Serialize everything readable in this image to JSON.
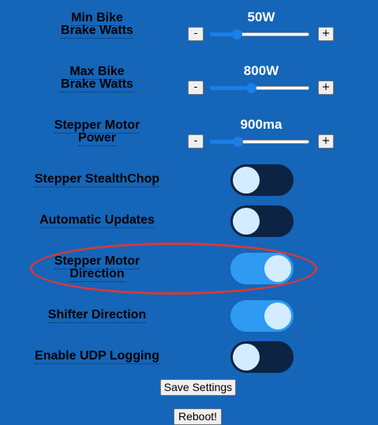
{
  "min_brake": {
    "line1": "Min Bike",
    "line2": "Brake Watts",
    "value": "50W",
    "minus": "-",
    "plus": "+",
    "level": 0.27
  },
  "max_brake": {
    "line1": "Max Bike",
    "line2": "Brake Watts",
    "value": "800W",
    "minus": "-",
    "plus": "+",
    "level": 0.41
  },
  "stepper_power": {
    "line1": "Stepper Motor",
    "line2": "Power",
    "value": "900ma",
    "minus": "-",
    "plus": "+",
    "level": 0.28
  },
  "toggles": [
    {
      "label": "Stepper StealthChop",
      "state": "off"
    },
    {
      "label": "Automatic Updates",
      "state": "off"
    },
    {
      "label_line1": "Stepper Motor",
      "label_line2": "Direction",
      "state": "on"
    },
    {
      "label": "Shifter Direction",
      "state": "on"
    },
    {
      "label": "Enable UDP Logging",
      "state": "off"
    }
  ],
  "buttons": {
    "save": "Save Settings",
    "reboot": "Reboot!"
  },
  "colors": {
    "background": "#1565b8",
    "toggle_on": "#2f9af2",
    "toggle_off": "#0c2344",
    "highlight_ring": "#d33a3a"
  }
}
